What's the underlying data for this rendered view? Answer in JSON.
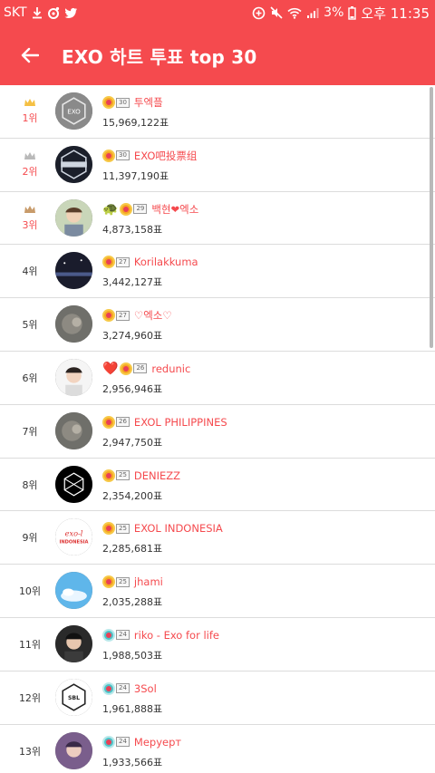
{
  "status": {
    "carrier": "SKT",
    "battery": "3%",
    "time": "오후 11:35"
  },
  "header": {
    "title": "EXO 하트 투표 top 30"
  },
  "colors": {
    "accent": "#f54a4e"
  },
  "rows": [
    {
      "rank": "1위",
      "crown": "gold",
      "level": "30",
      "name": "투엑플",
      "votes": "15,969,122표",
      "avatar": "exo-logo-gray",
      "deco": ""
    },
    {
      "rank": "2위",
      "crown": "silver",
      "level": "30",
      "name": "EXO吧投票组",
      "votes": "11,397,190표",
      "avatar": "exo-logo-dark",
      "deco": ""
    },
    {
      "rank": "3위",
      "crown": "bronze",
      "level": "29",
      "name": "백현❤엑소",
      "votes": "4,873,158표",
      "avatar": "person-light",
      "deco": "🐢"
    },
    {
      "rank": "4위",
      "crown": "",
      "level": "27",
      "name": "Korilakkuma",
      "votes": "3,442,127표",
      "avatar": "stage-dark",
      "deco": ""
    },
    {
      "rank": "5위",
      "crown": "",
      "level": "27",
      "name": "♡엑소♡",
      "votes": "3,274,960표",
      "avatar": "blur-gray",
      "deco": ""
    },
    {
      "rank": "6위",
      "crown": "",
      "level": "26",
      "name": "redunic",
      "votes": "2,956,946표",
      "avatar": "person-white",
      "deco": "❤️"
    },
    {
      "rank": "7위",
      "crown": "",
      "level": "26",
      "name": "EXOL PHILIPPINES",
      "votes": "2,947,750표",
      "avatar": "blur-gray",
      "deco": ""
    },
    {
      "rank": "8위",
      "crown": "",
      "level": "25",
      "name": "DENIEZZ",
      "votes": "2,354,200표",
      "avatar": "exo-hex-black",
      "deco": ""
    },
    {
      "rank": "9위",
      "crown": "",
      "level": "25",
      "name": "EXOL INDONESIA",
      "votes": "2,285,681표",
      "avatar": "exol-indonesia",
      "deco": ""
    },
    {
      "rank": "10위",
      "crown": "",
      "level": "25",
      "name": "jhami",
      "votes": "2,035,288표",
      "avatar": "sky-blue",
      "deco": ""
    },
    {
      "rank": "11위",
      "crown": "",
      "level": "24",
      "name": "riko - Exo for life",
      "votes": "1,988,503표",
      "avatar": "person-dark",
      "deco": ""
    },
    {
      "rank": "12위",
      "crown": "",
      "level": "24",
      "name": "3Sol",
      "votes": "1,961,888표",
      "avatar": "exo-hex-white",
      "deco": ""
    },
    {
      "rank": "13위",
      "crown": "",
      "level": "24",
      "name": "Меруерт",
      "votes": "1,933,566표",
      "avatar": "person-purple",
      "deco": ""
    }
  ]
}
